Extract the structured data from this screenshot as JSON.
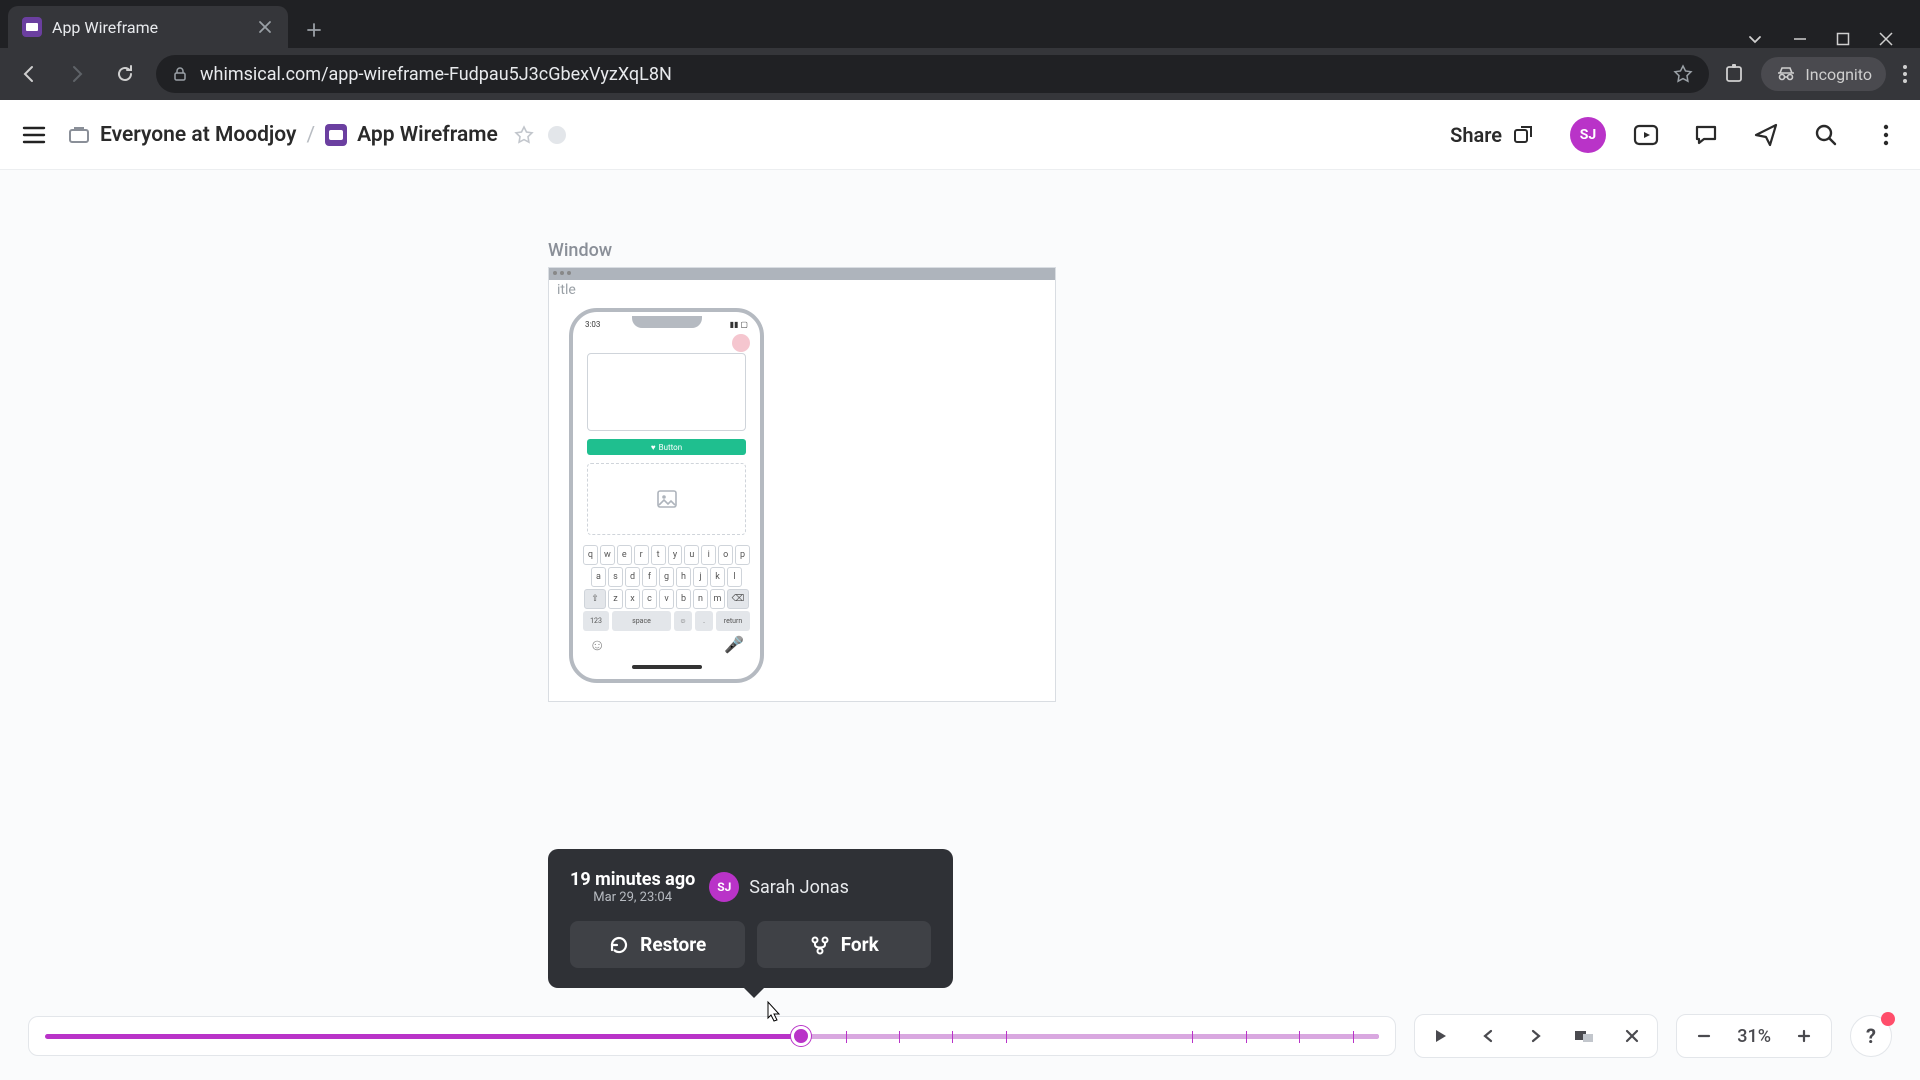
{
  "browser": {
    "tab_title": "App Wireframe",
    "url": "whimsical.com/app-wireframe-Fudpau5J3cGbexVyzXqL8N",
    "incognito_label": "Incognito"
  },
  "header": {
    "workspace": "Everyone at Moodjoy",
    "doc_title": "App Wireframe",
    "share_label": "Share",
    "avatar_initials": "SJ"
  },
  "wireframe": {
    "label": "Window",
    "subtitle": "itle",
    "phone_time": "3:03",
    "button_label": "Button"
  },
  "keyboard": {
    "row1": [
      "q",
      "w",
      "e",
      "r",
      "t",
      "y",
      "u",
      "i",
      "o",
      "p"
    ],
    "row2": [
      "a",
      "s",
      "d",
      "f",
      "g",
      "h",
      "j",
      "k",
      "l"
    ],
    "row3": [
      "z",
      "x",
      "c",
      "v",
      "b",
      "n",
      "m"
    ],
    "bottom": {
      "num": "123",
      "space": "space",
      "ret": "return"
    }
  },
  "history": {
    "relative": "19 minutes ago",
    "absolute": "Mar 29, 23:04",
    "user_name": "Sarah Jonas",
    "user_initials": "SJ",
    "restore_label": "Restore",
    "fork_label": "Fork"
  },
  "zoom": {
    "value": "31%"
  }
}
